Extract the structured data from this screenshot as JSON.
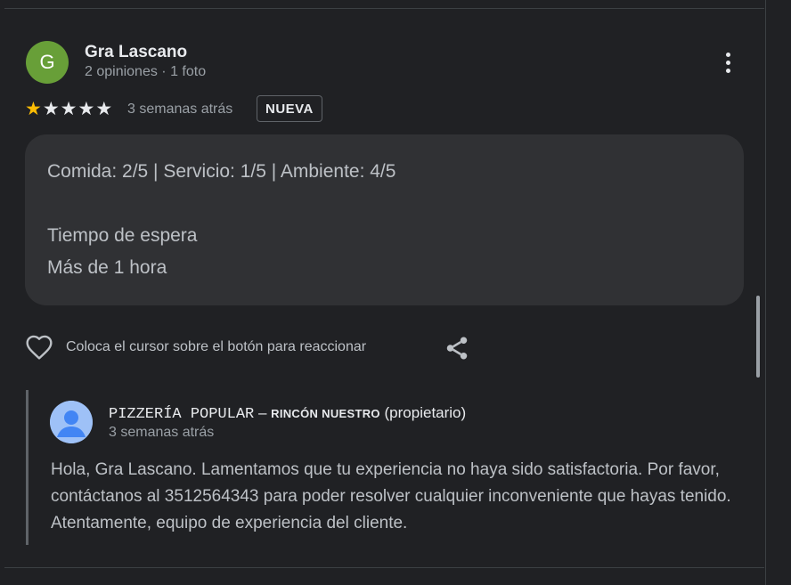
{
  "review": {
    "author_initial": "G",
    "author_name": "Gra Lascano",
    "author_meta": "2 opiniones · 1 foto",
    "rating": 1,
    "rating_max": 5,
    "date": "3 semanas atrás",
    "badge": "NUEVA",
    "lines": [
      "Comida: 2/5  |  Servicio: 1/5  |  Ambiente: 4/5",
      "Tiempo de espera",
      "Más de 1 hora"
    ],
    "react_hint": "Coloca el cursor sobre el botón para reaccionar"
  },
  "owner_response": {
    "business_name": "PIZZERÍA POPULAR",
    "dash": " – ",
    "location": "RINCÓN NUESTRO",
    "role": " (propietario)",
    "date": "3 semanas atrás",
    "text": "Hola, Gra Lascano. Lamentamos que tu experiencia no haya sido satisfactoria. Por favor, contáctanos al 3512564343 para poder resolver cualquier inconveniente que hayas tenido. Atentamente, equipo de experiencia del cliente."
  },
  "colors": {
    "background": "#202124",
    "card": "#303134",
    "star_filled": "#fbbc04",
    "avatar": "#689f38",
    "owner_avatar": "#9ec1f7"
  },
  "icons": [
    "more-vert-icon",
    "star-icon",
    "heart-icon",
    "share-icon",
    "person-icon"
  ]
}
